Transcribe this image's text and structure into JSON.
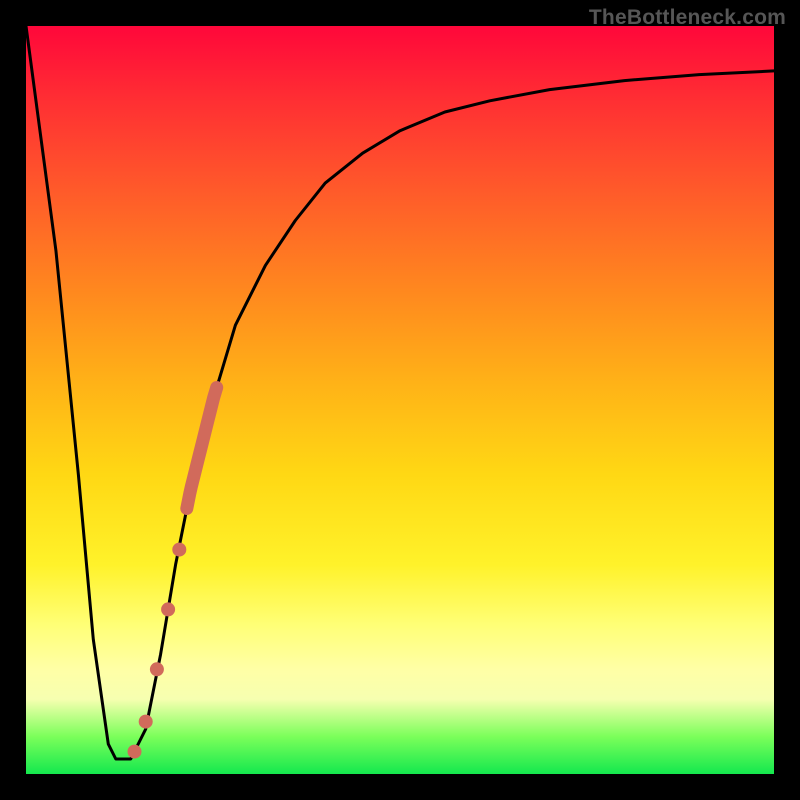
{
  "watermark": "TheBottleneck.com",
  "chart_data": {
    "type": "line",
    "title": "",
    "xlabel": "",
    "ylabel": "",
    "xlim": [
      0,
      100
    ],
    "ylim": [
      0,
      100
    ],
    "series": [
      {
        "name": "bottleneck-curve",
        "x": [
          0,
          4,
          7,
          9,
          11,
          12,
          14,
          16,
          18,
          20,
          22,
          25,
          28,
          32,
          36,
          40,
          45,
          50,
          56,
          62,
          70,
          80,
          90,
          100
        ],
        "y": [
          100,
          70,
          40,
          18,
          4,
          2,
          2,
          6,
          16,
          28,
          38,
          50,
          60,
          68,
          74,
          79,
          83,
          86,
          88.5,
          90,
          91.5,
          92.7,
          93.5,
          94
        ]
      }
    ],
    "markers": [
      {
        "name": "segment",
        "x_range": [
          21.5,
          25.5
        ],
        "thick": true
      },
      {
        "name": "dot",
        "x": 20.5,
        "y": 30
      },
      {
        "name": "dot",
        "x": 19.0,
        "y": 22
      },
      {
        "name": "dot",
        "x": 17.5,
        "y": 14
      },
      {
        "name": "dot",
        "x": 16.0,
        "y": 7
      },
      {
        "name": "dot",
        "x": 14.5,
        "y": 3
      }
    ],
    "colors": {
      "curve": "#000000",
      "markers": "#d16a5b"
    }
  }
}
